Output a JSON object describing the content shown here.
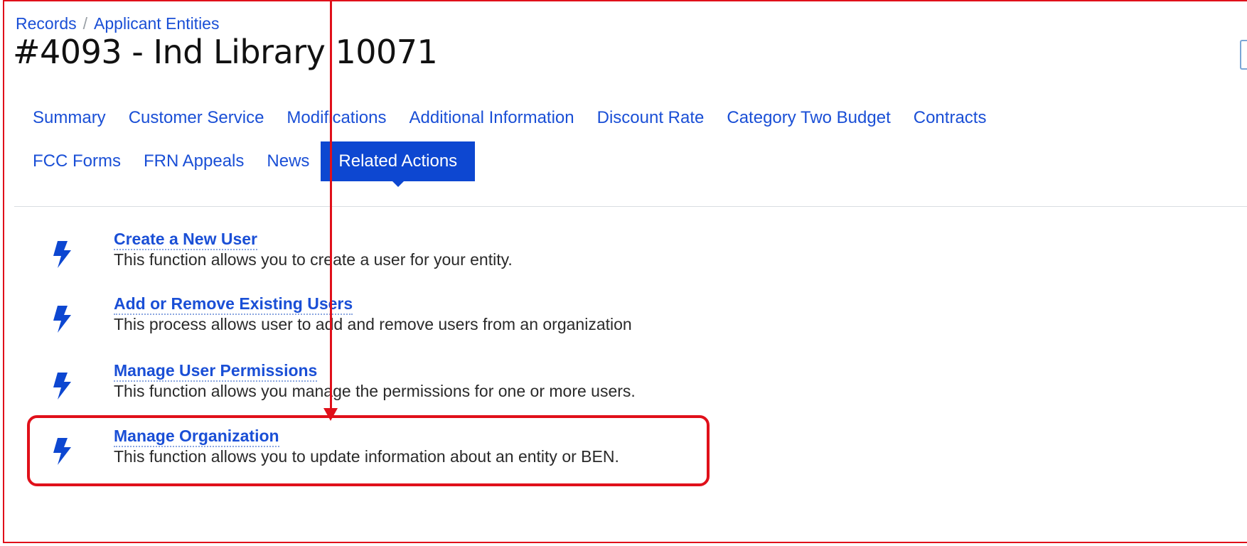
{
  "breadcrumb": {
    "records": "Records",
    "separator": "/",
    "applicant_entities": "Applicant Entities"
  },
  "page": {
    "title": "#4093 - Ind Library 10071"
  },
  "tabs_row1": [
    {
      "label": "Summary"
    },
    {
      "label": "Customer Service"
    },
    {
      "label": "Modifications"
    },
    {
      "label": "Additional Information"
    },
    {
      "label": "Discount Rate"
    },
    {
      "label": "Category Two Budget"
    },
    {
      "label": "Contracts"
    }
  ],
  "tabs_row2": [
    {
      "label": "FCC Forms"
    },
    {
      "label": "FRN Appeals"
    },
    {
      "label": "News"
    },
    {
      "label": "Related Actions",
      "active": true
    }
  ],
  "actions": [
    {
      "title": "Create a New User",
      "description": "This function allows you to create a user for your entity.",
      "icon": "bolt-icon"
    },
    {
      "title": "Add or Remove Existing Users",
      "description": "This process allows user to add and remove users from an organization",
      "icon": "bolt-icon"
    },
    {
      "title": "Manage User Permissions",
      "description": "This function allows you manage the permissions for one or more users.",
      "icon": "bolt-icon"
    },
    {
      "title": "Manage Organization",
      "description": "This function allows you to update information about an entity or BEN.",
      "icon": "bolt-icon"
    }
  ],
  "colors": {
    "link": "#1a4fd6",
    "active_tab": "#0d47d1",
    "annotation": "#e0101a"
  }
}
